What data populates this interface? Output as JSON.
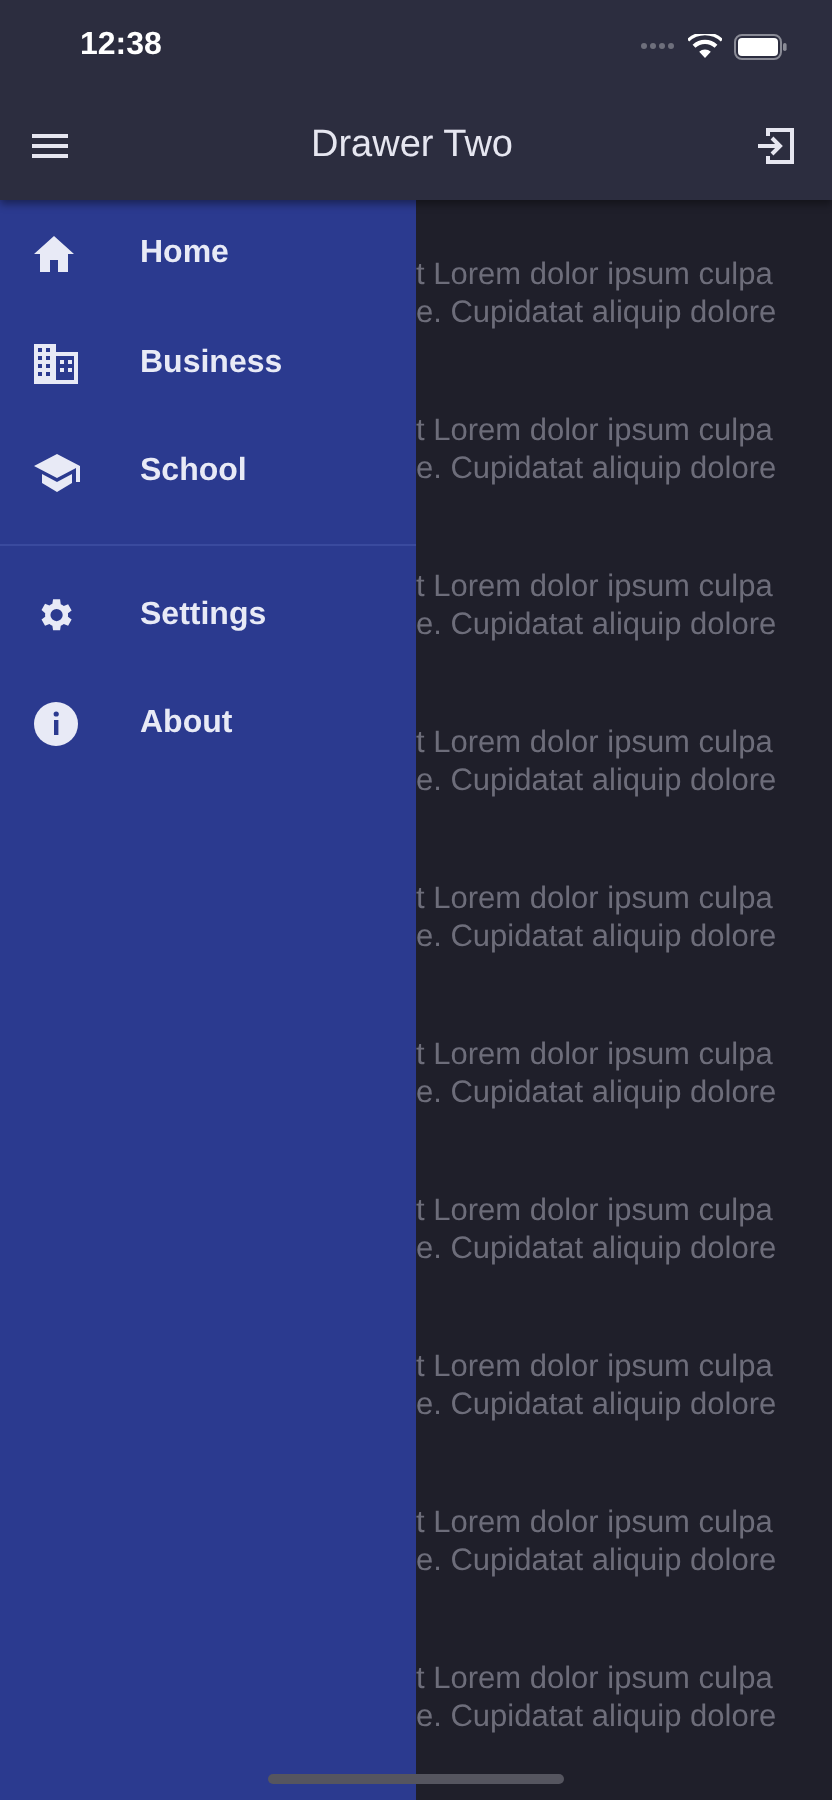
{
  "status_bar": {
    "time": "12:38"
  },
  "app_bar": {
    "title": "Drawer Two"
  },
  "drawer": {
    "sections": [
      {
        "items": [
          {
            "label": "Home"
          },
          {
            "label": "Business"
          },
          {
            "label": "School"
          }
        ]
      },
      {
        "items": [
          {
            "label": "Settings"
          },
          {
            "label": "About"
          }
        ]
      }
    ]
  },
  "content": {
    "cards": [
      {
        "line_1": "t Lorem dolor ipsum culpa",
        "line_2": "e. Cupidatat aliquip dolore"
      },
      {
        "line_1": "t Lorem dolor ipsum culpa",
        "line_2": "e. Cupidatat aliquip dolore"
      },
      {
        "line_1": "t Lorem dolor ipsum culpa",
        "line_2": "e. Cupidatat aliquip dolore"
      },
      {
        "line_1": "t Lorem dolor ipsum culpa",
        "line_2": "e. Cupidatat aliquip dolore"
      },
      {
        "line_1": "t Lorem dolor ipsum culpa",
        "line_2": "e. Cupidatat aliquip dolore"
      },
      {
        "line_1": "t Lorem dolor ipsum culpa",
        "line_2": "e. Cupidatat aliquip dolore"
      },
      {
        "line_1": "t Lorem dolor ipsum culpa",
        "line_2": "e. Cupidatat aliquip dolore"
      },
      {
        "line_1": "t Lorem dolor ipsum culpa",
        "line_2": "e. Cupidatat aliquip dolore"
      },
      {
        "line_1": "t Lorem dolor ipsum culpa",
        "line_2": "e. Cupidatat aliquip dolore"
      },
      {
        "line_1": "t Lorem dolor ipsum culpa",
        "line_2": "e. Cupidatat aliquip dolore"
      }
    ]
  }
}
